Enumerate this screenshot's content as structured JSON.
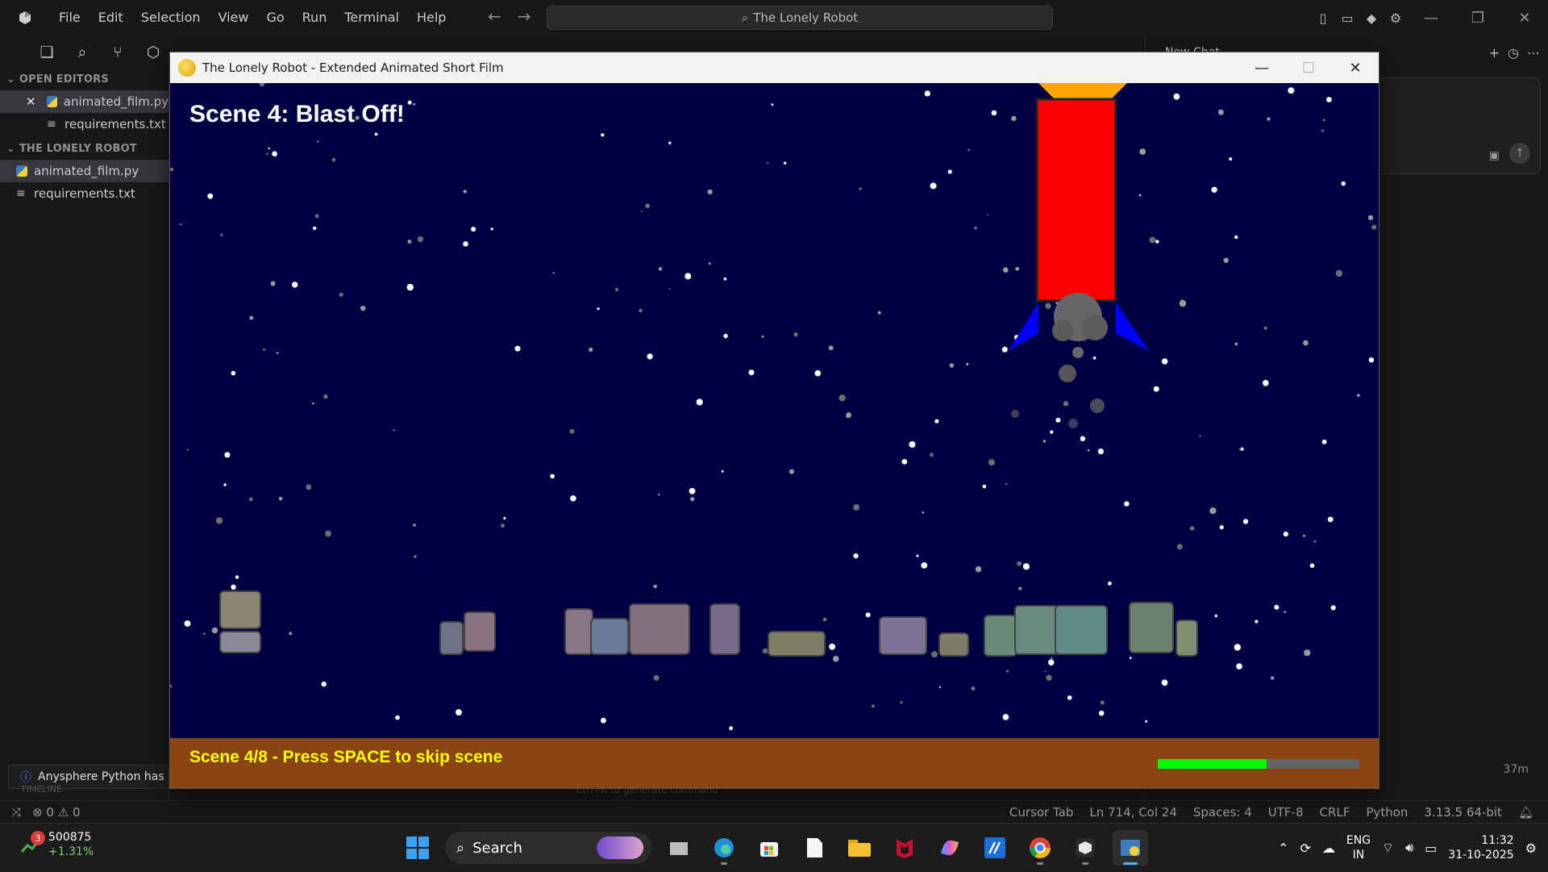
{
  "ide": {
    "menu": [
      "File",
      "Edit",
      "Selection",
      "View",
      "Go",
      "Run",
      "Terminal",
      "Help"
    ],
    "command_center": "The Lonely Robot",
    "sidebar": {
      "open_editors_title": "OPEN EDITORS",
      "open_editors": [
        {
          "name": "animated_film.py",
          "type": "python",
          "dirty_close": true
        },
        {
          "name": "requirements.txt",
          "type": "text"
        }
      ],
      "project_title": "THE LONELY ROBOT",
      "files": [
        {
          "name": "animated_film.py",
          "type": "python",
          "selected": true
        },
        {
          "name": "requirements.txt",
          "type": "text"
        }
      ]
    },
    "notification": "Anysphere Python has b",
    "ghost_hint": "Ctrl+K to generate command",
    "ghost_timeline": "TIMELINE",
    "chat": {
      "header": "New Chat",
      "time": "37m"
    },
    "statusbar": {
      "errors": "0",
      "warnings": "0",
      "items": [
        "Cursor Tab",
        "Ln 714, Col 24",
        "Spaces: 4",
        "UTF-8",
        "CRLF",
        "Python",
        "3.13.5 64-bit"
      ]
    }
  },
  "game_window": {
    "title": "The Lonely Robot - Extended Animated Short Film",
    "scene_title": "Scene 4: Blast Off!",
    "scene_hint": "Scene 4/8 - Press SPACE to skip scene",
    "scene_progress": 0.54,
    "colors": {
      "sky": "#000044",
      "rocket_body": "#ff0000",
      "rocket_nose": "#ffa500",
      "fins": "#0000ff",
      "bar": "#8b4513",
      "hint_text": "#ffff00",
      "progress": "#00ff00"
    }
  },
  "taskbar": {
    "stock_value": "500875",
    "stock_change": "+1.31%",
    "stock_badge": "3",
    "search_label": "Search",
    "lang_top": "ENG",
    "lang_bottom": "IN",
    "time": "11:32",
    "date": "31-10-2025",
    "apps": [
      "windows-start-icon",
      "task-view-icon",
      "edge-icon",
      "store-icon",
      "notepad-icon",
      "file-explorer-icon",
      "mcafee-icon",
      "copilot-icon",
      "code-app-icon",
      "chrome-icon",
      "cursor-app-icon",
      "python-app-icon"
    ]
  }
}
